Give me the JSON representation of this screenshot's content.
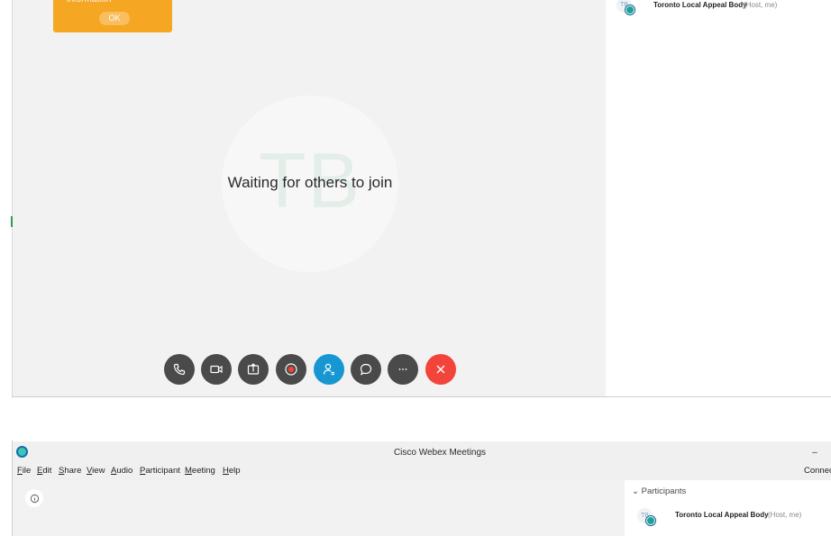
{
  "top_window": {
    "notice": {
      "text": "information",
      "ok_label": "OK"
    },
    "stage": {
      "avatar_initials": "TB",
      "waiting_text": "Waiting for others to join"
    },
    "controls": [
      "audio",
      "video",
      "share",
      "record",
      "participants",
      "chat",
      "more",
      "end"
    ],
    "participant": {
      "initials": "TB",
      "name": "Toronto Local Appeal Body",
      "role": "(Host, me)"
    }
  },
  "bottom_window": {
    "title": "Cisco Webex Meetings",
    "minimize_label": "–",
    "connect_label": "Connec",
    "menu": {
      "file": {
        "u": "F",
        "rest": "ile"
      },
      "edit": {
        "u": "E",
        "rest": "dit"
      },
      "share": {
        "u": "S",
        "rest": "hare"
      },
      "view": {
        "u": "V",
        "rest": "iew"
      },
      "audio": {
        "u": "A",
        "rest": "udio"
      },
      "participant": {
        "u": "P",
        "rest": "articipant"
      },
      "meeting": {
        "u": "M",
        "rest": "eeting"
      },
      "help": {
        "u": "H",
        "rest": "elp"
      }
    },
    "participants_header": "Participants",
    "participant": {
      "initials": "TB",
      "name": "Toronto Local Appeal Body",
      "role": "(Host, me)"
    }
  },
  "colors": {
    "accent_orange": "#f5a623",
    "participants_blue": "#1797d1",
    "end_red": "#f2443b",
    "control_gray": "#4a4a4a"
  }
}
